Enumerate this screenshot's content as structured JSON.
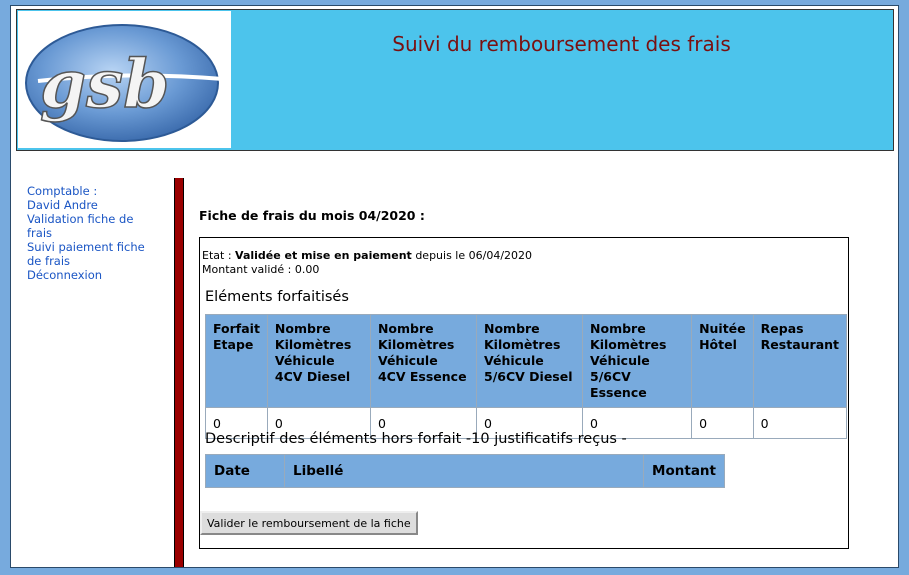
{
  "header": {
    "logo_text": "gsb",
    "title": "Suivi du remboursement des frais"
  },
  "menu": {
    "role_label": "Comptable :",
    "user_name": "David Andre",
    "items": [
      {
        "label": "Validation fiche de frais"
      },
      {
        "label": "Suivi paiement fiche de frais"
      },
      {
        "label": "Déconnexion"
      }
    ]
  },
  "main": {
    "title": "Fiche de frais du mois 04/2020 :",
    "status": {
      "etat_label": "Etat :",
      "etat_value": "Validée et mise en paiement",
      "since_text": "depuis le 06/04/2020",
      "montant_label": "Montant validé :",
      "montant_value": "0.00"
    },
    "forfait_title": "Eléments forfaitisés",
    "forfait_headers": [
      "Forfait Etape",
      "Nombre Kilomètres Véhicule 4CV Diesel",
      "Nombre Kilomètres Véhicule 4CV Essence",
      "Nombre Kilomètres Véhicule 5/6CV Diesel",
      "Nombre Kilomètres Véhicule 5/6CV Essence",
      "Nuitée Hôtel",
      "Repas Restaurant"
    ],
    "forfait_values": [
      "0",
      "0",
      "0",
      "0",
      "0",
      "0",
      "0"
    ],
    "hors_forfait_title": "Descriptif des éléments hors forfait -10 justificatifs reçus -",
    "hors_forfait_headers": [
      "Date",
      "Libellé",
      "Montant"
    ],
    "validate_button": "Valider le remboursement de la fiche"
  },
  "colors": {
    "header_bg": "#4cc4ec",
    "page_bg": "#77aadd",
    "title_color": "#7a1010",
    "menu_link": "#1a55c4",
    "table_header": "#77aadd",
    "side_bar": "#9a0000"
  }
}
